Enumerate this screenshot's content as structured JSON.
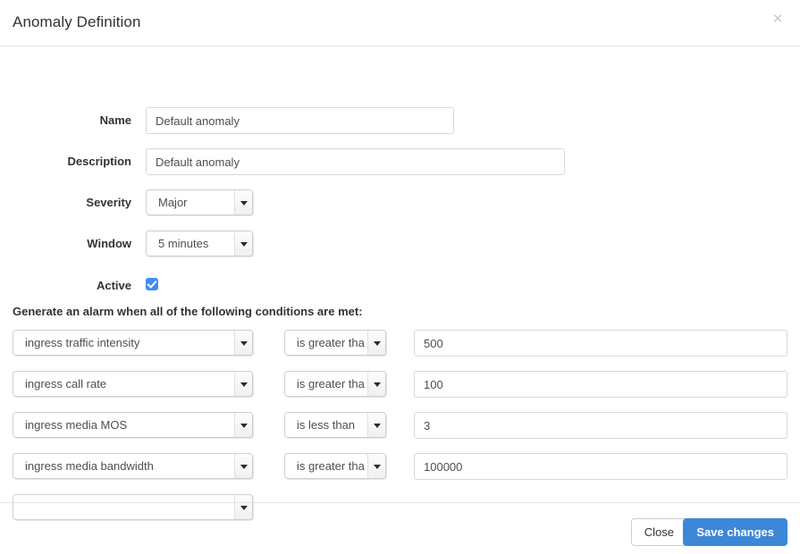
{
  "dialog": {
    "title": "Anomaly Definition",
    "close_icon": "×"
  },
  "fields": {
    "name": {
      "label": "Name",
      "value": "Default anomaly",
      "placeholder": ""
    },
    "description": {
      "label": "Description",
      "value": "Default anomaly",
      "placeholder": ""
    },
    "severity": {
      "label": "Severity",
      "value": "Major"
    },
    "window": {
      "label": "Window",
      "value": "5 minutes"
    },
    "active": {
      "label": "Active",
      "checked": true
    }
  },
  "conditions": {
    "caption": "Generate an alarm when all of the following conditions are met:",
    "rows": [
      {
        "metric": "ingress traffic intensity",
        "operator": "is greater tha",
        "value": "500"
      },
      {
        "metric": "ingress call rate",
        "operator": "is greater tha",
        "value": "100"
      },
      {
        "metric": "ingress media MOS",
        "operator": "is less than",
        "value": "3"
      },
      {
        "metric": "ingress media bandwidth",
        "operator": "is greater tha",
        "value": "100000"
      },
      {
        "metric": "",
        "operator": "",
        "value": ""
      }
    ]
  },
  "footer": {
    "close_label": "Close",
    "save_label": "Save changes"
  },
  "colors": {
    "accent": "#3d87d8",
    "checkbox": "#3e8ef7",
    "border": "#d8d8d8"
  }
}
